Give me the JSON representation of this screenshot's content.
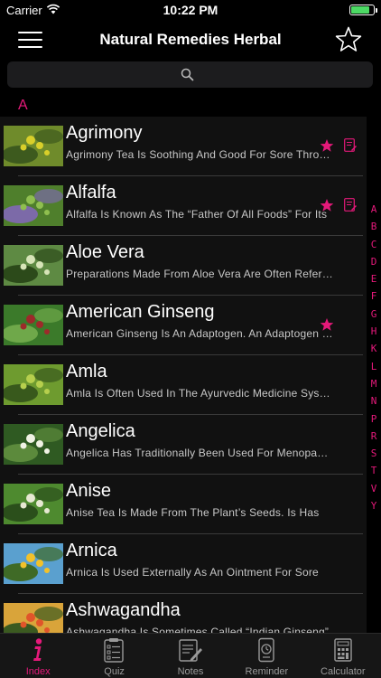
{
  "status_bar": {
    "carrier": "Carrier",
    "time": "10:22 PM",
    "battery_level": 0.85
  },
  "nav": {
    "title": "Natural Remedies Herbal",
    "menu_icon": "hamburger-menu-icon",
    "favorite_icon": "star-outline-icon"
  },
  "search": {
    "placeholder": "",
    "icon": "search-icon"
  },
  "section_header": "A",
  "herbs": [
    {
      "name": "Agrimony",
      "description": "Agrimony Tea Is Soothing And Good For Sore Throats",
      "favorite": true,
      "has_note": true,
      "thumb_colors": [
        "#6f8b2b",
        "#d9cf2a",
        "#3d5a1e"
      ]
    },
    {
      "name": "Alfalfa",
      "description": "Alfalfa Is Known As The “Father Of All Foods” For Its",
      "favorite": true,
      "has_note": true,
      "thumb_colors": [
        "#4f7f2c",
        "#8fbf4f",
        "#7c6aa8"
      ]
    },
    {
      "name": "Aloe Vera",
      "description": "Preparations Made From Aloe Vera Are Often Referred To",
      "favorite": false,
      "has_note": false,
      "thumb_colors": [
        "#5e8a43",
        "#d7e4b8",
        "#2c4a1a"
      ]
    },
    {
      "name": "American Ginseng",
      "description": "American Ginseng Is An Adaptogen. An Adaptogen Helps",
      "favorite": true,
      "has_note": false,
      "thumb_colors": [
        "#3b7a2a",
        "#9d2a2a",
        "#6fa84a"
      ]
    },
    {
      "name": "Amla",
      "description": "Amla Is Often Used In The Ayurvedic Medicine System",
      "favorite": false,
      "has_note": false,
      "thumb_colors": [
        "#6e9b2f",
        "#b6cf4d",
        "#38591c"
      ]
    },
    {
      "name": "Angelica",
      "description": "Angelica Has Traditionally Been Used For Menopausal",
      "favorite": false,
      "has_note": false,
      "thumb_colors": [
        "#2f5a22",
        "#f0f2e4",
        "#5c8a3c"
      ]
    },
    {
      "name": "Anise",
      "description": "Anise Tea Is Made From The Plant’s Seeds. Is Has",
      "favorite": false,
      "has_note": false,
      "thumb_colors": [
        "#4e8a2f",
        "#e6e8d2",
        "#2b4f1b"
      ]
    },
    {
      "name": "Arnica",
      "description": "Arnica Is Used Externally As An Ointment For Sore",
      "favorite": false,
      "has_note": false,
      "thumb_colors": [
        "#5aa0cf",
        "#f2c12a",
        "#3f6a26"
      ]
    },
    {
      "name": "Ashwagandha",
      "description": "Ashwagandha Is Sometimes Called “Indian Ginseng”",
      "favorite": false,
      "has_note": false,
      "thumb_colors": [
        "#d9a43a",
        "#e0552a",
        "#3b5a20"
      ]
    }
  ],
  "index_letters": [
    "A",
    "B",
    "C",
    "D",
    "E",
    "F",
    "G",
    "H",
    "K",
    "L",
    "M",
    "N",
    "P",
    "R",
    "S",
    "T",
    "V",
    "Y"
  ],
  "tabs": [
    {
      "label": "Index",
      "icon": "info-icon",
      "active": true
    },
    {
      "label": "Quiz",
      "icon": "quiz-clipboard-icon",
      "active": false
    },
    {
      "label": "Notes",
      "icon": "notes-pencil-icon",
      "active": false
    },
    {
      "label": "Reminder",
      "icon": "reminder-clock-icon",
      "active": false
    },
    {
      "label": "Calculator",
      "icon": "calculator-icon",
      "active": false
    }
  ],
  "colors": {
    "accent": "#e5197a",
    "background": "#000000",
    "list_background": "#111111",
    "text_secondary": "#c8c8c8"
  }
}
